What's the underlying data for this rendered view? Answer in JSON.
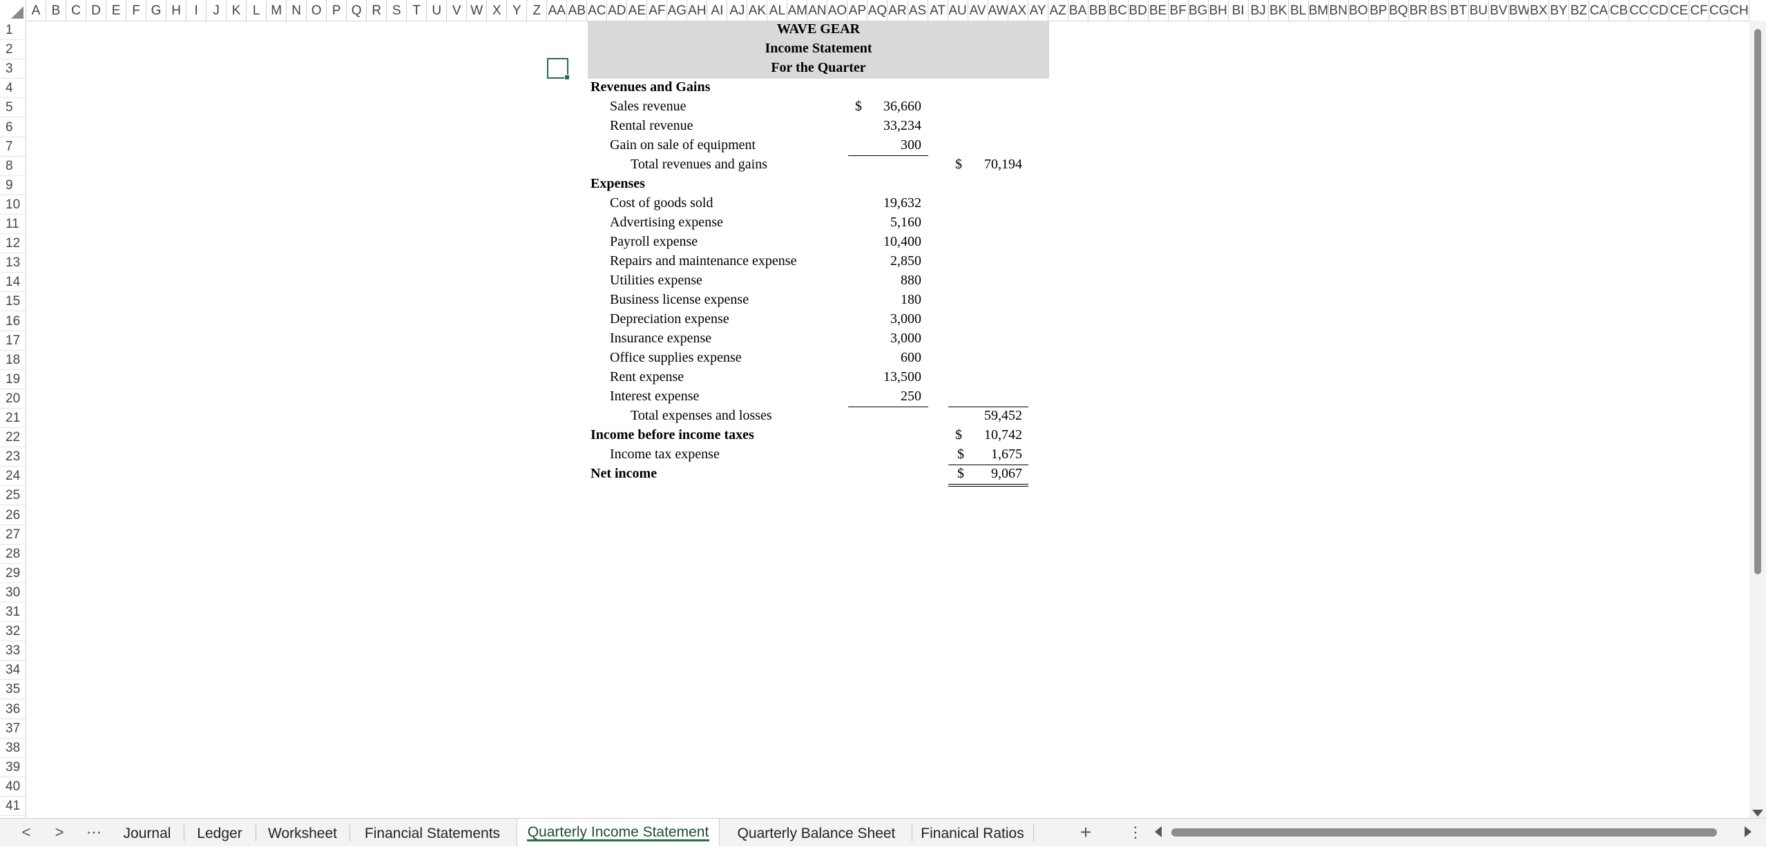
{
  "columns": [
    "A",
    "B",
    "C",
    "D",
    "E",
    "F",
    "G",
    "H",
    "I",
    "J",
    "K",
    "L",
    "M",
    "N",
    "O",
    "P",
    "Q",
    "R",
    "S",
    "T",
    "U",
    "V",
    "W",
    "X",
    "Y",
    "Z",
    "AA",
    "AB",
    "AC",
    "AD",
    "AE",
    "AF",
    "AG",
    "AH",
    "AI",
    "AJ",
    "AK",
    "AL",
    "AM",
    "AN",
    "AO",
    "AP",
    "AQ",
    "AR",
    "AS",
    "AT",
    "AU",
    "AV",
    "AW",
    "AX",
    "AY",
    "AZ",
    "BA",
    "BB",
    "BC",
    "BD",
    "BE",
    "BF",
    "BG",
    "BH",
    "BI",
    "BJ",
    "BK",
    "BL",
    "BM",
    "BN",
    "BO",
    "BP",
    "BQ",
    "BR",
    "BS",
    "BT",
    "BU",
    "BV",
    "BW",
    "BX",
    "BY",
    "BZ",
    "CA",
    "CB",
    "CC",
    "CD",
    "CE",
    "CF",
    "CG",
    "CH"
  ],
  "rows": [
    "1",
    "2",
    "3",
    "4",
    "5",
    "6",
    "7",
    "8",
    "9",
    "10",
    "11",
    "12",
    "13",
    "14",
    "15",
    "16",
    "17",
    "18",
    "19",
    "20",
    "21",
    "22",
    "23",
    "24",
    "25",
    "26",
    "27",
    "28",
    "29",
    "30",
    "31",
    "32",
    "33",
    "34",
    "35",
    "36",
    "37",
    "38",
    "39",
    "40",
    "41"
  ],
  "statement": {
    "company": "WAVE GEAR",
    "title": "Income Statement",
    "period": "For the Quarter",
    "revenues_header": "Revenues and Gains",
    "revenues": [
      {
        "label": "Sales revenue",
        "currency": "$",
        "amount": "36,660"
      },
      {
        "label": "Rental revenue",
        "currency": "",
        "amount": "33,234"
      },
      {
        "label": "Gain on sale of equipment",
        "currency": "",
        "amount": "300"
      }
    ],
    "total_revenues": {
      "label": "Total revenues and gains",
      "currency": "$",
      "amount": "70,194"
    },
    "expenses_header": "Expenses",
    "expenses": [
      {
        "label": "Cost of goods sold",
        "amount": "19,632"
      },
      {
        "label": "Advertising expense",
        "amount": "5,160"
      },
      {
        "label": "Payroll expense",
        "amount": "10,400"
      },
      {
        "label": "Repairs and maintenance expense",
        "amount": "2,850"
      },
      {
        "label": "Utilities expense",
        "amount": "880"
      },
      {
        "label": "Business license expense",
        "amount": "180"
      },
      {
        "label": "Depreciation expense",
        "amount": "3,000"
      },
      {
        "label": "Insurance expense",
        "amount": "3,000"
      },
      {
        "label": "Office supplies expense",
        "amount": "600"
      },
      {
        "label": "Rent expense",
        "amount": "13,500"
      },
      {
        "label": "Interest expense",
        "amount": "250"
      }
    ],
    "total_expenses": {
      "label": "Total expenses and losses",
      "amount": "59,452"
    },
    "income_before_tax": {
      "label": "Income before income taxes",
      "currency": "$",
      "amount": "10,742"
    },
    "tax_expense": {
      "label": "Income tax expense",
      "currency": "$",
      "amount": "1,675"
    },
    "net_income": {
      "label": "Net income",
      "currency": "$",
      "amount": "9,067"
    }
  },
  "sheet_tabs": {
    "prev": "<",
    "next": ">",
    "more": "⋯",
    "tabs": [
      "Journal",
      "Ledger",
      "Worksheet",
      "Financial Statements",
      "Quarterly Income Statement",
      "Quarterly Balance Sheet",
      "Finanical Ratios"
    ],
    "active_tab": "Quarterly Income Statement",
    "add": "+",
    "options": "⋮"
  },
  "colors": {
    "accent": "#1e7145",
    "title_band": "#d9d9d9"
  }
}
